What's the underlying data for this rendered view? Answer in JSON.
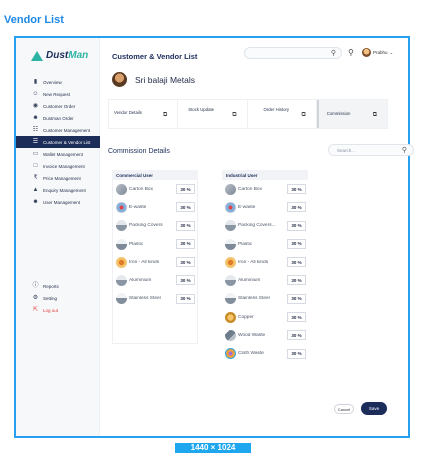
{
  "canvas": {
    "title": "Vendor List",
    "size_badge": "1440 × 1024"
  },
  "sidebar": {
    "logo": {
      "text_main": "Dust",
      "text_accent": "Man"
    },
    "items": [
      {
        "label": "Overview",
        "icon": "bar-chart-icon"
      },
      {
        "label": "New Request",
        "icon": "users-icon"
      },
      {
        "label": "Customer Order",
        "icon": "globe-icon"
      },
      {
        "label": "Dustman Order",
        "icon": "person-icon"
      },
      {
        "label": "Customer Management",
        "icon": "network-icon"
      },
      {
        "label": "Customer & Vendor List",
        "icon": "list-icon",
        "active": true
      },
      {
        "label": "Wallet Management",
        "icon": "wallet-icon"
      },
      {
        "label": "Invoice Management",
        "icon": "invoice-icon"
      },
      {
        "label": "Price Management",
        "icon": "rupee-icon"
      },
      {
        "label": "Enquiry Management",
        "icon": "enquiry-icon"
      },
      {
        "label": "User Management",
        "icon": "user-manage-icon"
      }
    ],
    "bottom_items": [
      {
        "label": "Reports",
        "icon": "info-icon"
      },
      {
        "label": "Setting",
        "icon": "gear-icon"
      },
      {
        "label": "Log out",
        "icon": "logout-icon"
      }
    ]
  },
  "header": {
    "title": "Customer & Vendor  List",
    "search_placeholder": "",
    "user_name": "Prabhu"
  },
  "vendor": {
    "name": "Sri balaji Metals"
  },
  "tabs": [
    {
      "label": "Vendor Details"
    },
    {
      "label": "Stock Update"
    },
    {
      "label": "Order History"
    },
    {
      "label": "Commission"
    }
  ],
  "commission": {
    "title": "Commission Details",
    "search_placeholder": "Search...",
    "commercial": {
      "header": "Commercial User",
      "items": [
        {
          "name": "Carton Box",
          "value": "30 %",
          "thumb": "box"
        },
        {
          "name": "E-waste",
          "value": "30 %",
          "thumb": "ewaste"
        },
        {
          "name": "Packing Covers",
          "value": "30 %",
          "thumb": "pack"
        },
        {
          "name": "Plastic",
          "value": "30 %",
          "thumb": "plastic"
        },
        {
          "name": "Iron - All kinds",
          "value": "30 %",
          "thumb": "iron"
        },
        {
          "name": "Aluminium",
          "value": "30 %",
          "thumb": "alu"
        },
        {
          "name": "Stainless Steel",
          "value": "30 %",
          "thumb": "steel"
        }
      ]
    },
    "industrial": {
      "header": "Industrial User",
      "items": [
        {
          "name": "Carton Box",
          "value": "30 %",
          "thumb": "box"
        },
        {
          "name": "E-waste",
          "value": "30 %",
          "thumb": "ewaste"
        },
        {
          "name": "Packing Covers...",
          "value": "30 %",
          "thumb": "pack"
        },
        {
          "name": "Plastic",
          "value": "30 %",
          "thumb": "plastic"
        },
        {
          "name": "Iron - All kinds",
          "value": "30 %",
          "thumb": "iron"
        },
        {
          "name": "Aluminium",
          "value": "30 %",
          "thumb": "alu"
        },
        {
          "name": "Stainless Steel",
          "value": "30 %",
          "thumb": "steel"
        },
        {
          "name": "Copper",
          "value": "30 %",
          "thumb": "copper"
        },
        {
          "name": "Wood Waste",
          "value": "30 %",
          "thumb": "wood"
        },
        {
          "name": "Cloth Waste",
          "value": "30 %",
          "thumb": "cloth"
        }
      ]
    }
  },
  "actions": {
    "cancel": "Cancel",
    "save": "Save"
  },
  "colors": {
    "accent": "#1c2d5a",
    "frame": "#27a0f0",
    "logo_accent": "#2bb3a3",
    "logout": "#e53935"
  }
}
